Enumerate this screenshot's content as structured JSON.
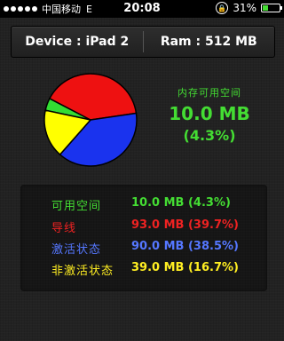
{
  "status_bar": {
    "carrier": "中国移动",
    "network": "E",
    "time": "20:08",
    "battery_pct_label": "31%",
    "battery_level": 0.31
  },
  "device": {
    "device_label": "Device : iPad 2",
    "ram_label": "Ram : 512 MB"
  },
  "summary": {
    "title": "内存可用空间",
    "value": "10.0 MB",
    "percent": "(4.3%)"
  },
  "chart_data": {
    "type": "pie",
    "slices": [
      {
        "name": "可用空间",
        "value": 4.3,
        "color": "#33dd33"
      },
      {
        "name": "导线",
        "value": 39.7,
        "color": "#ee1111"
      },
      {
        "name": "激活状态",
        "value": 38.5,
        "color": "#1a33ee"
      },
      {
        "name": "非激活状态",
        "value": 16.7,
        "color": "#ffff00"
      }
    ]
  },
  "stats": [
    {
      "label": "可用空间",
      "value": "10.0 MB (4.3%)",
      "color": "#44dd33"
    },
    {
      "label": "导线",
      "value": "93.0 MB (39.7%)",
      "color": "#ee2222"
    },
    {
      "label": "激活状态",
      "value": "90.0 MB (38.5%)",
      "color": "#5577ff"
    },
    {
      "label": "非激活状态",
      "value": "39.0 MB (16.7%)",
      "color": "#ffee22"
    }
  ]
}
